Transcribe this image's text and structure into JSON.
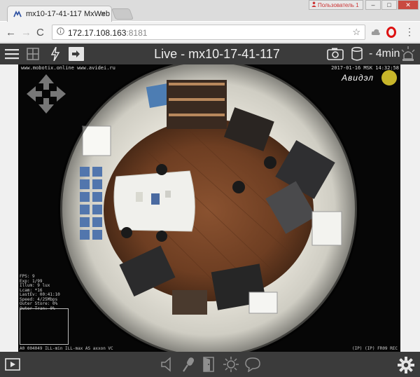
{
  "browser": {
    "tab_title": "mx10-17-41-117 MxWeb",
    "tab_close": "×",
    "profile_label": "Пользователь 1",
    "url_host": "172.17.108.163",
    "url_port": ":8181",
    "nav": {
      "back": "←",
      "forward": "→",
      "reload": "C"
    },
    "star": "☆",
    "menu": "⋮",
    "window_buttons": {
      "minimize": "–",
      "maximize": "□",
      "close": "✕"
    }
  },
  "app": {
    "title": "Live - mx10-17-41-117",
    "duration_label": "- 4min",
    "accent": "#e8d021"
  },
  "video": {
    "osd_top_left": "www.mobotix.online www.avidei.ru",
    "osd_top_right": "2017-01-16 MSK 14:32:58",
    "brand": "Авидэл",
    "stats": [
      "FPS: 9",
      "Exp: 1/99",
      "Illum: 9 lux",
      "Lcam: *16",
      "LastEv: 00:41:10",
      "Speed: 4/25Mbps",
      "Outer Store: 0%",
      "Outer Tran: 0%"
    ],
    "osd_bottom_left": "A0 004049 ILL-min ILL-max AS axxon VC",
    "osd_bottom_right": "(IP) (IP) FR09 REC"
  },
  "icons": [
    "hamburger-icon",
    "layout-grid-icon",
    "lightning-icon",
    "stream-icon",
    "snapshot-camera-icon",
    "storage-icon",
    "alarm-light-icon",
    "play-icon",
    "speaker-icon",
    "microphone-icon",
    "door-icon",
    "light-icon",
    "chat-icon",
    "settings-icon"
  ]
}
